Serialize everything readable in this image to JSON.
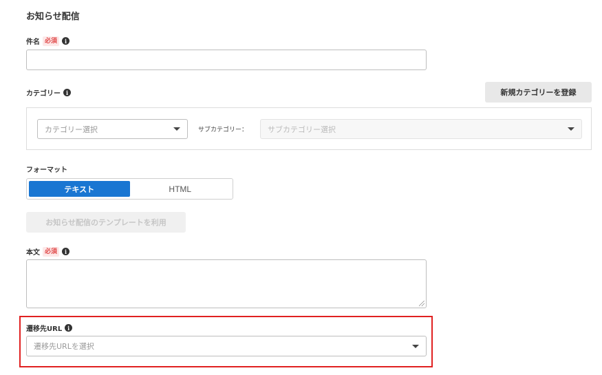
{
  "page": {
    "title": "お知らせ配信"
  },
  "subject": {
    "label": "件名",
    "required": "必須",
    "value": ""
  },
  "category": {
    "label": "カテゴリー",
    "new_button": "新規カテゴリーを登録",
    "select_placeholder": "カテゴリー選択",
    "sub_label": "サブカテゴリー：",
    "sub_placeholder": "サブカテゴリー選択"
  },
  "format": {
    "label": "フォーマット",
    "options": [
      "テキスト",
      "HTML"
    ],
    "selected": "テキスト"
  },
  "template_button": "お知らせ配信のテンプレートを利用",
  "body": {
    "label": "本文",
    "required": "必須",
    "value": ""
  },
  "dest_url": {
    "label": "遷移先URL",
    "placeholder": "遷移先URLを選択"
  },
  "colors": {
    "accent": "#1976d2",
    "required_text": "#e04848",
    "highlight": "#e02020"
  },
  "icons": {
    "info": "info-icon",
    "dropdown": "caret-down-icon"
  }
}
